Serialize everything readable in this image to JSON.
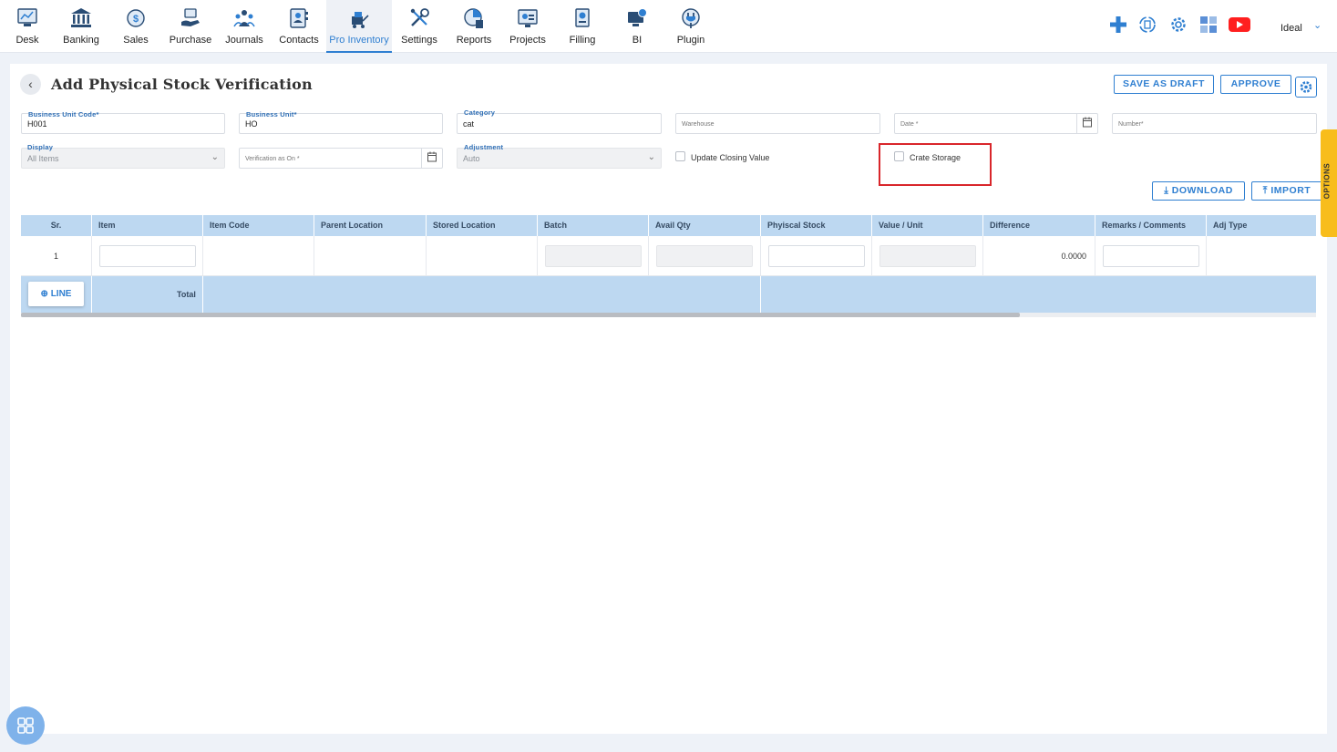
{
  "nav": {
    "items": [
      {
        "label": "Desk",
        "icon": "desk-icon"
      },
      {
        "label": "Banking",
        "icon": "bank-icon"
      },
      {
        "label": "Sales",
        "icon": "sales-icon"
      },
      {
        "label": "Purchase",
        "icon": "purchase-icon"
      },
      {
        "label": "Journals",
        "icon": "journals-icon"
      },
      {
        "label": "Contacts",
        "icon": "contacts-icon"
      },
      {
        "label": "Pro Inventory",
        "icon": "pro-inventory-icon"
      },
      {
        "label": "Settings",
        "icon": "settings-tools-icon"
      },
      {
        "label": "Reports",
        "icon": "reports-icon"
      },
      {
        "label": "Projects",
        "icon": "projects-icon"
      },
      {
        "label": "Filling",
        "icon": "filling-icon"
      },
      {
        "label": "BI",
        "icon": "bi-icon"
      },
      {
        "label": "Plugin",
        "icon": "plugin-icon"
      }
    ],
    "active": "Pro Inventory",
    "tools": [
      "plus-icon",
      "sync-icon",
      "gear-icon",
      "apps-grid-icon",
      "youtube-icon"
    ],
    "user": "Ideal"
  },
  "page": {
    "title": "Add Physical Stock Verification",
    "buttons": {
      "save_draft": "SAVE AS DRAFT",
      "approve": "APPROVE",
      "download": "DOWNLOAD",
      "import": "IMPORT"
    },
    "options_tab": "OPTIONS"
  },
  "form": {
    "business_unit_code": {
      "label": "Business Unit Code",
      "value": "H001"
    },
    "business_unit": {
      "label": "Business Unit",
      "value": "HO"
    },
    "category": {
      "label": "Category",
      "value": "cat"
    },
    "warehouse": {
      "placeholder": "Warehouse"
    },
    "date": {
      "placeholder": "Date"
    },
    "number": {
      "placeholder": "Number"
    },
    "display": {
      "label": "Display",
      "value": "All Items"
    },
    "verification_as_on": {
      "placeholder": "Verification as On"
    },
    "adjustment": {
      "label": "Adjustment",
      "value": "Auto"
    },
    "update_closing_value": {
      "label": "Update Closing Value",
      "checked": false
    },
    "crate_storage": {
      "label": "Crate Storage",
      "checked": false
    }
  },
  "table": {
    "columns": [
      "Sr.",
      "Item",
      "Item Code",
      "Parent Location",
      "Stored Location",
      "Batch",
      "Avail Qty",
      "Phyiscal Stock",
      "Value / Unit",
      "Difference",
      "Remarks / Comments",
      "Adj Type"
    ],
    "rows": [
      {
        "sr": "1",
        "difference": "0.0000"
      }
    ],
    "footer": {
      "add_line": "LINE",
      "total": "Total"
    }
  },
  "colors": {
    "accent": "#2f7fd1",
    "table_header": "#bdd8f1",
    "options_tab": "#f8bd1c",
    "highlight": "#d9262b"
  }
}
